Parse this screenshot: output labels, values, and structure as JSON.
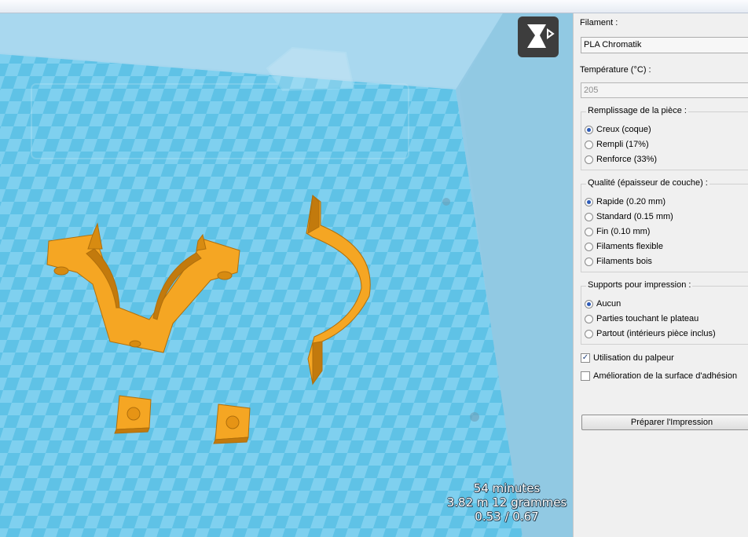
{
  "colors": {
    "part": "#f5a623",
    "plate": "#5bbfe3",
    "panel": "#f0f0f0"
  },
  "icons": {
    "logo": "app-logo-icon"
  },
  "print_info": {
    "time": "54 minutes",
    "material": "3.82 m 12 grammes",
    "ratio": "0.53 / 0.67"
  },
  "panel": {
    "filament_label": "Filament :",
    "filament_value": "PLA Chromatik",
    "temperature_label": "Température (°C) :",
    "temperature_value": "205",
    "infill": {
      "title": "Remplissage de la pièce :",
      "options": [
        "Creux (coque)",
        "Rempli (17%)",
        "Renforce (33%)"
      ],
      "selected": 0
    },
    "quality": {
      "title": "Qualité (épaisseur de couche) :",
      "options": [
        "Rapide (0.20 mm)",
        "Standard (0.15 mm)",
        "Fin (0.10 mm)",
        "Filaments flexible",
        "Filaments bois"
      ],
      "selected": 0
    },
    "supports": {
      "title": "Supports pour impression :",
      "options": [
        "Aucun",
        "Parties touchant le plateau",
        "Partout (intérieurs pièce inclus)"
      ],
      "selected": 0
    },
    "probe_label": "Utilisation du palpeur",
    "probe_checked": true,
    "adhesion_label": "Amélioration de la surface d'adhésion",
    "adhesion_checked": false,
    "prepare_button": "Préparer l'Impression"
  }
}
